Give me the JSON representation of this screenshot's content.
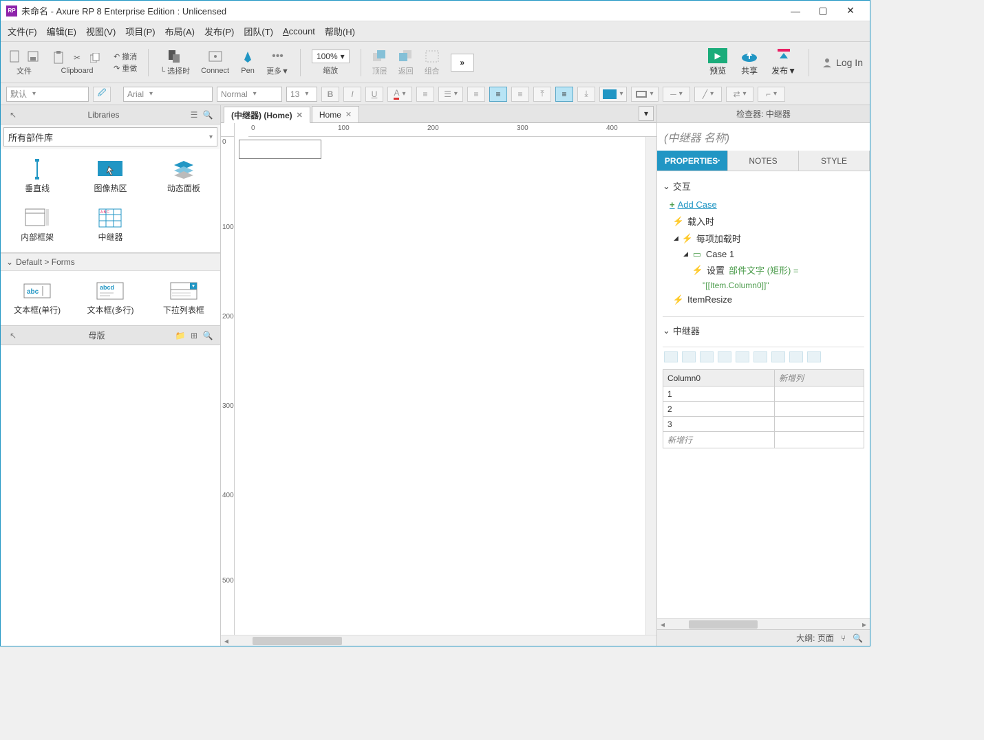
{
  "titlebar": {
    "app_badge": "RP",
    "title": "未命名 - Axure RP 8 Enterprise Edition : Unlicensed"
  },
  "menu": {
    "file": "文件(F)",
    "edit": "编辑(E)",
    "view": "视图(V)",
    "project": "项目(P)",
    "arrange": "布局(A)",
    "publish": "发布(P)",
    "team": "团队(T)",
    "account": "Account",
    "help": "帮助(H)"
  },
  "toolbar": {
    "file": "文件",
    "clipboard": "Clipboard",
    "undo": "撤消",
    "redo": "重做",
    "select": "选择时",
    "connect": "Connect",
    "pen": "Pen",
    "more": "更多▼",
    "zoom_value": "100%",
    "zoom_label": "缩放",
    "top": "顶层",
    "back": "返回",
    "group": "组合",
    "preview": "预览",
    "share": "共享",
    "publish": "发布▼",
    "login": "Log In"
  },
  "format": {
    "default": "默认",
    "font": "Arial",
    "weight": "Normal",
    "size": "13"
  },
  "left": {
    "libraries_title": "Libraries",
    "lib_select": "所有部件库",
    "widgets1": [
      "垂直线",
      "图像热区",
      "动态面板"
    ],
    "widgets2": [
      "内部框架",
      "中继器"
    ],
    "forms_header": "Default > Forms",
    "forms": [
      "文本框(单行)",
      "文本框(多行)",
      "下拉列表框"
    ],
    "masters_title": "母版"
  },
  "tabs": {
    "active": "(中继器) (Home)",
    "second": "Home"
  },
  "ruler_h": [
    "0",
    "100",
    "200",
    "300",
    "400"
  ],
  "ruler_v": [
    "0",
    "100",
    "200",
    "300",
    "400",
    "500"
  ],
  "inspector": {
    "title": "检查器: 中继器",
    "name_placeholder": "(中继器 名称)",
    "tab_properties": "PROPERTIES",
    "tab_notes": "NOTES",
    "tab_style": "STYLE",
    "section_interactions": "交互",
    "add_case": "Add Case",
    "ev_onload": "载入时",
    "ev_itemload": "每项加载时",
    "case1": "Case 1",
    "action_set": "设置",
    "action_target": "部件文字 (矩形) =",
    "action_value": "\"[[Item.Column0]]\"",
    "ev_resize": "ItemResize",
    "section_repeater": "中继器",
    "col0": "Column0",
    "col_new": "新增列",
    "rows": [
      "1",
      "2",
      "3"
    ],
    "row_new": "新增行"
  },
  "footer": {
    "outline": "大纲: 页面"
  }
}
